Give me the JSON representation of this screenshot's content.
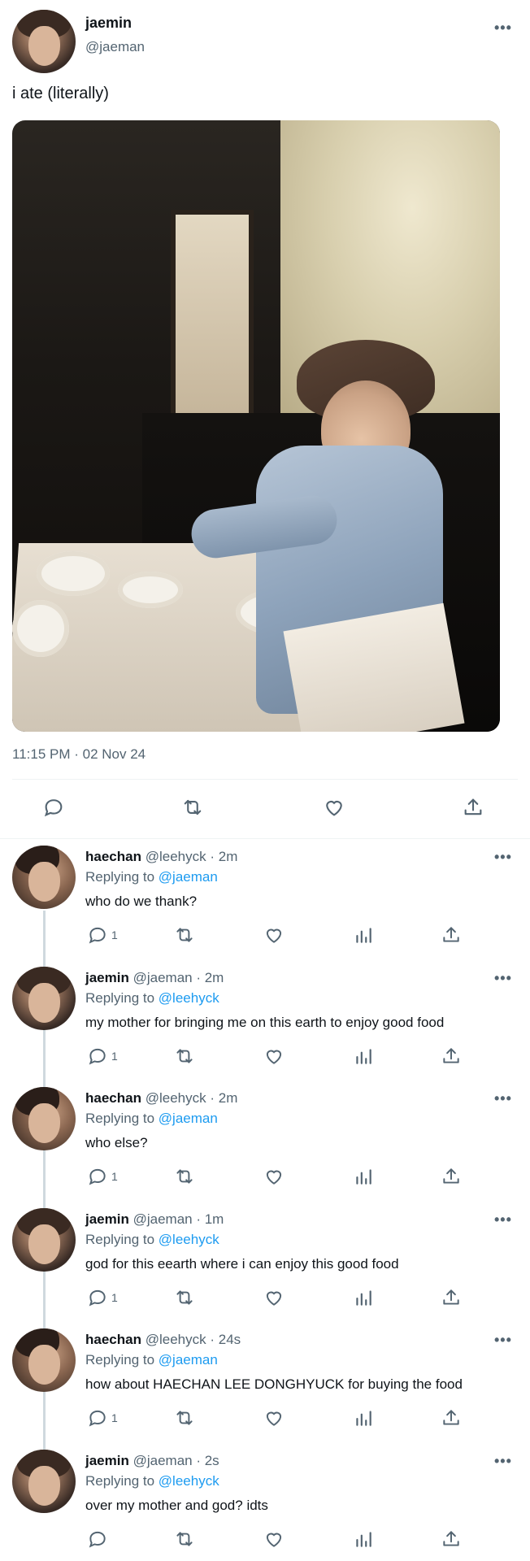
{
  "main_tweet": {
    "author_name": "jaemin",
    "author_handle": "@jaeman",
    "text": "i ate (literally)",
    "timestamp": "11:15 PM · 02 Nov 24",
    "menu_label": "•••"
  },
  "replies": [
    {
      "name": "haechan",
      "handle": "@leehyck",
      "time": "· 2m",
      "replying_label": "Replying to",
      "replying_to": "@jaeman",
      "text": "who do we thank?",
      "reply_count": "1"
    },
    {
      "name": "jaemin",
      "handle": "@jaeman",
      "time": "· 2m",
      "replying_label": "Replying to",
      "replying_to": "@leehyck",
      "text": "my mother for bringing me on this earth to enjoy good food",
      "reply_count": "1"
    },
    {
      "name": "haechan",
      "handle": "@leehyck",
      "time": "· 2m",
      "replying_label": "Replying to",
      "replying_to": "@jaeman",
      "text": "who else?",
      "reply_count": "1"
    },
    {
      "name": "jaemin",
      "handle": "@jaeman",
      "time": "· 1m",
      "replying_label": "Replying to",
      "replying_to": "@leehyck",
      "text": "god for this eearth where i can enjoy this good food",
      "reply_count": "1"
    },
    {
      "name": "haechan",
      "handle": "@leehyck",
      "time": "· 24s",
      "replying_label": "Replying to",
      "replying_to": "@jaeman",
      "text": "how about HAECHAN LEE DONGHYUCK for buying the food",
      "reply_count": "1"
    },
    {
      "name": "jaemin",
      "handle": "@jaeman",
      "time": "· 2s",
      "replying_label": "Replying to",
      "replying_to": "@leehyck",
      "text": "over my mother and god? idts",
      "reply_count": ""
    }
  ],
  "colors": {
    "accent": "#1d9bf0",
    "muted": "#536471",
    "text": "#0f1419",
    "divider": "#eff3f4"
  },
  "icons": [
    "reply-icon",
    "retweet-icon",
    "like-icon",
    "views-icon",
    "share-icon",
    "more-icon"
  ]
}
